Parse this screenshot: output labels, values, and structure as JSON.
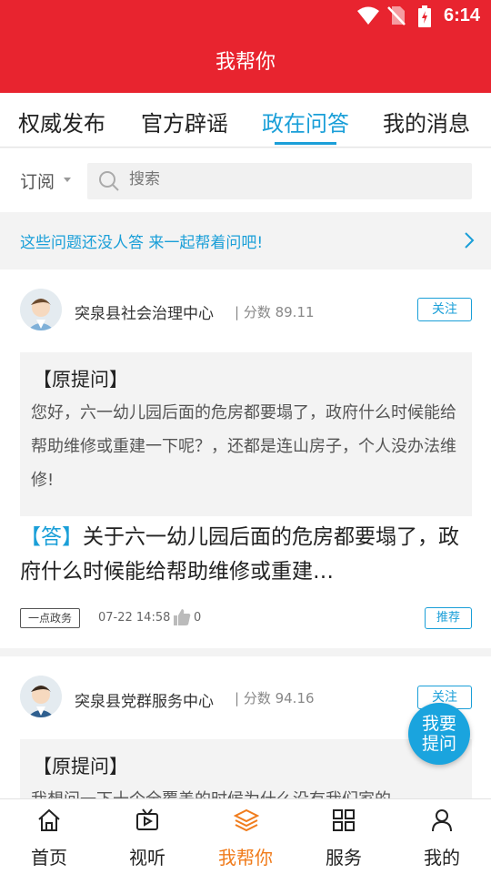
{
  "status_bar": {
    "time": "6:14"
  },
  "header": {
    "title": "我帮你"
  },
  "tabs": [
    {
      "label": "权威发布",
      "active": false
    },
    {
      "label": "官方辟谣",
      "active": false
    },
    {
      "label": "政在问答",
      "active": true
    },
    {
      "label": "我的消息",
      "active": false
    }
  ],
  "search": {
    "subscribe_label": "订阅",
    "placeholder": "搜索"
  },
  "banner": {
    "text": "这些问题还没人答 来一起帮着问吧!"
  },
  "cards": [
    {
      "org": "突泉县社会治理中心",
      "score": "| 分数 89.11",
      "follow_label": "关注",
      "question_head": "【原提问】",
      "question_text": "您好，六一幼儿园后面的危房都要塌了，政府什么时候能给帮助维修或重建一下呢？，还都是连山房子，个人没办法维修!",
      "answer_mark": "【答】",
      "answer_text": "关于六一幼儿园后面的危房都要塌了，政府什么时候能给帮助维修或重建…",
      "tag": "一点政务",
      "time": "07-22 14:58",
      "likes": "0",
      "recommend_label": "推荐"
    },
    {
      "org": "突泉县党群服务中心",
      "score": "| 分数 94.16",
      "follow_label": "关注",
      "question_head": "【原提问】",
      "question_text": "我想问一下十个全覆盖的时候为什么没有我们家的"
    }
  ],
  "fab": {
    "line1": "我要",
    "line2": "提问"
  },
  "bottom_nav": [
    {
      "label": "首页",
      "icon": "home-icon",
      "active": false
    },
    {
      "label": "视听",
      "icon": "tv-icon",
      "active": false
    },
    {
      "label": "我帮你",
      "icon": "layers-icon",
      "active": true
    },
    {
      "label": "服务",
      "icon": "grid-icon",
      "active": false
    },
    {
      "label": "我的",
      "icon": "user-icon",
      "active": false
    }
  ],
  "colors": {
    "brand_red": "#e8242f",
    "accent_blue": "#1a9fd8",
    "active_orange": "#f07c1c"
  }
}
